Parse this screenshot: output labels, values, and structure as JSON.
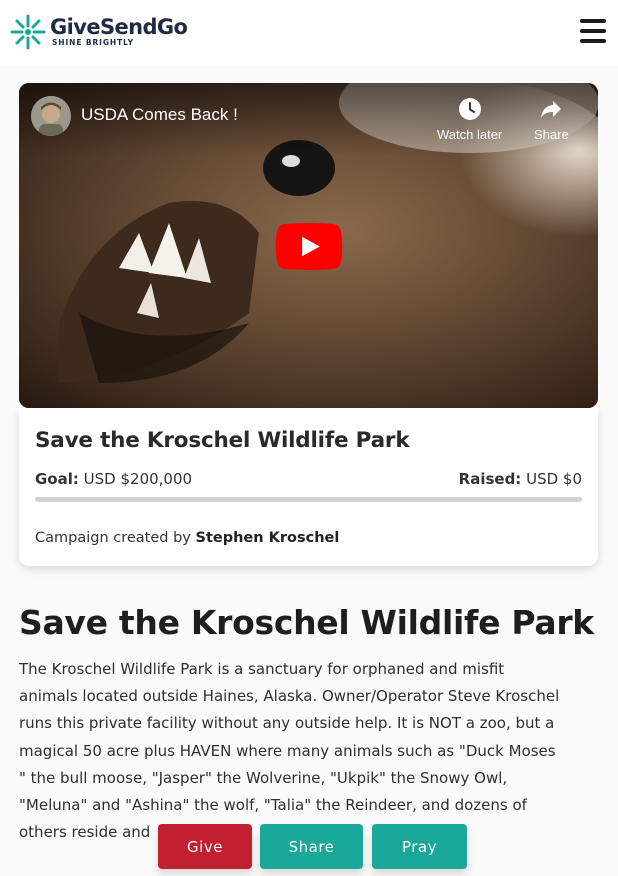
{
  "brand": {
    "name": "GiveSendGo",
    "tagline": "SHINE BRIGHTLY",
    "colors": {
      "navy": "#1f2a44",
      "teal": "#1aa89a",
      "red": "#c0202f"
    }
  },
  "header": {
    "menu_icon": "hamburger-menu-icon"
  },
  "video": {
    "title": "USDA Comes Back !",
    "watch_later_label": "Watch later",
    "share_label": "Share",
    "play_icon": "youtube-play-icon"
  },
  "card": {
    "title": "Save the Kroschel Wildlife Park",
    "goal_label": "Goal:",
    "goal_value": "USD $200,000",
    "raised_label": "Raised:",
    "raised_value": "USD $0",
    "progress_fraction": 0,
    "creator_prefix": "Campaign created by",
    "creator_name": "Stephen Kroschel"
  },
  "content": {
    "title": "Save the Kroschel Wildlife Park",
    "description": "The Kroschel Wildlife Park is a sanctuary for orphaned and misfit animals located outside Haines, Alaska. Owner/Operator Steve Kroschel runs this private facility without any outside help. It is NOT a zoo, but a magical 50 acre plus HAVEN where many animals such as \"Duck Moses \" the bull moose, \"Jasper\" the Wolverine, \"Ukpik\" the Snowy Owl, \"Meluna\" and \"Ashina\" the wolf, \"Talia\" the Reindeer, and dozens of others reside and"
  },
  "actions": {
    "give_label": "Give",
    "share_label": "Share",
    "pray_label": "Pray"
  }
}
